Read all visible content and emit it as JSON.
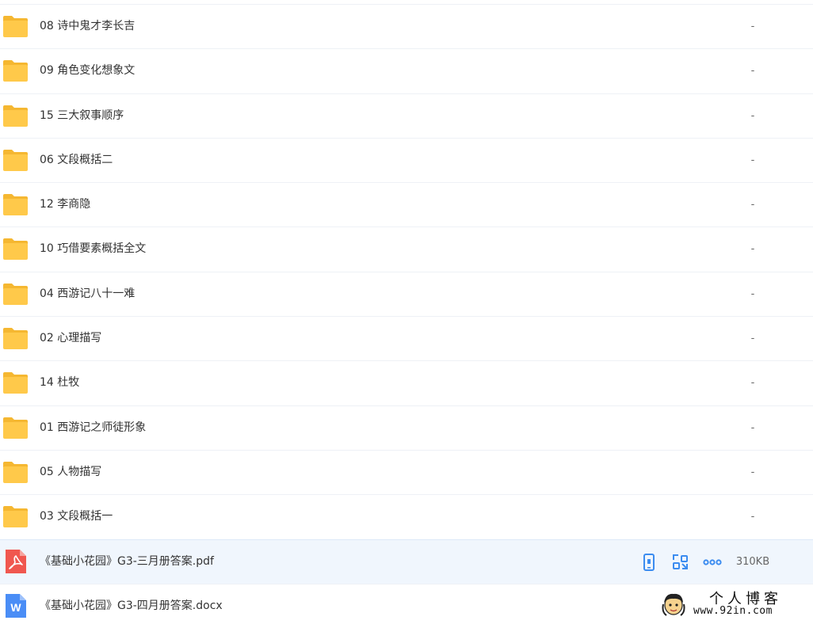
{
  "files": [
    {
      "name": "08 诗中鬼才李长吉",
      "size": "-",
      "type": "folder"
    },
    {
      "name": "09 角色变化想象文",
      "size": "-",
      "type": "folder"
    },
    {
      "name": "15 三大叙事顺序",
      "size": "-",
      "type": "folder"
    },
    {
      "name": "06 文段概括二",
      "size": "-",
      "type": "folder"
    },
    {
      "name": "12 李商隐",
      "size": "-",
      "type": "folder"
    },
    {
      "name": "10 巧借要素概括全文",
      "size": "-",
      "type": "folder"
    },
    {
      "name": "04 西游记八十一难",
      "size": "-",
      "type": "folder"
    },
    {
      "name": "02 心理描写",
      "size": "-",
      "type": "folder"
    },
    {
      "name": "14 杜牧",
      "size": "-",
      "type": "folder"
    },
    {
      "name": "01 西游记之师徒形象",
      "size": "-",
      "type": "folder"
    },
    {
      "name": "05 人物描写",
      "size": "-",
      "type": "folder"
    },
    {
      "name": "03 文段概括一",
      "size": "-",
      "type": "folder"
    },
    {
      "name": "《基础小花园》G3-三月册答案.pdf",
      "size": "310KB",
      "type": "pdf",
      "selected": true
    },
    {
      "name": "《基础小花园》G3-四月册答案.docx",
      "size": "",
      "type": "docx"
    }
  ],
  "row_actions": [
    "phone-icon",
    "share-link-icon",
    "more-dots-icon"
  ],
  "watermark": {
    "title": "个人博客",
    "url": "www.92in.com"
  },
  "colors": {
    "folder": "#ffc94a",
    "folder_tab": "#f5b731",
    "pdf": "#f0574f",
    "docx": "#4a8df6",
    "action": "#3b8cf0",
    "selected_bg": "#f0f6fd",
    "divider": "#eef1f6"
  },
  "icons": {
    "folder": "folder-icon",
    "pdf": "pdf-file-icon",
    "docx": "word-file-icon"
  }
}
